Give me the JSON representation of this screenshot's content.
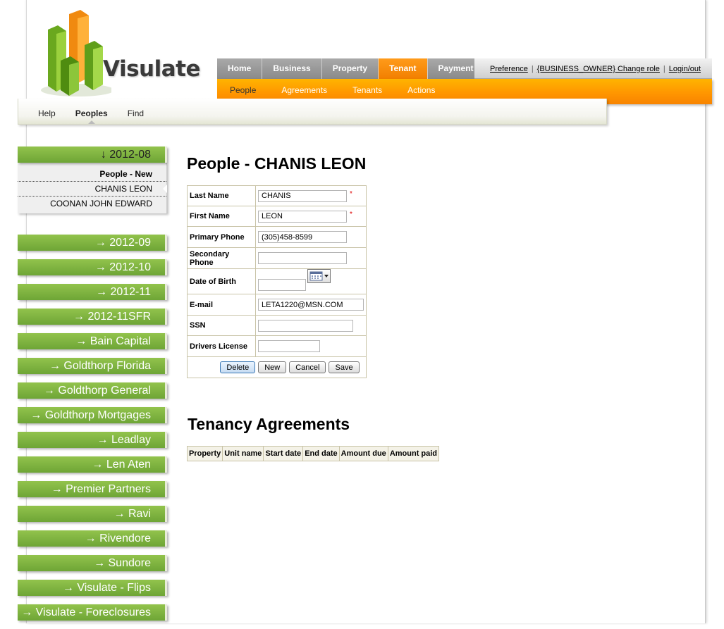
{
  "brand": {
    "name": "Visulate"
  },
  "topnav": {
    "tabs": [
      {
        "label": "Home",
        "active": false
      },
      {
        "label": "Business",
        "active": false
      },
      {
        "label": "Property",
        "active": false
      },
      {
        "label": "Tenant",
        "active": true
      },
      {
        "label": "Payment",
        "active": false
      }
    ],
    "links": [
      "Preference",
      "{BUSINESS_OWNER} Change role",
      "Login/out"
    ]
  },
  "subnav": {
    "items": [
      {
        "label": "People",
        "active": true
      },
      {
        "label": "Agreements",
        "active": false
      },
      {
        "label": "Tenants",
        "active": false
      },
      {
        "label": "Actions",
        "active": false
      }
    ]
  },
  "tertnav": {
    "items": [
      {
        "label": "Help",
        "active": false
      },
      {
        "label": "Peoples",
        "active": true
      },
      {
        "label": "Find",
        "active": false
      }
    ]
  },
  "sidebar": {
    "open_group": "↓ 2012-08",
    "submenu": [
      "People - New",
      "CHANIS LEON",
      "COONAN JOHN EDWARD"
    ],
    "groups": [
      "→ 2012-09",
      "→ 2012-10",
      "→ 2012-11",
      "→ 2012-11SFR",
      "→ Bain Capital",
      "→ Goldthorp Florida",
      "→ Goldthorp General",
      "→ Goldthorp Mortgages",
      "→ Leadlay",
      "→ Len Aten",
      "→ Premier Partners",
      "→ Ravi",
      "→ Rivendore",
      "→ Sundore",
      "→ Visulate - Flips",
      "→ Visulate - Foreclosures"
    ]
  },
  "people": {
    "title": "People - CHANIS LEON",
    "fields": {
      "last_name": {
        "label": "Last Name",
        "value": "CHANIS",
        "required": "*"
      },
      "first_name": {
        "label": "First Name",
        "value": "LEON",
        "required": "*"
      },
      "primary_phone": {
        "label": "Primary Phone",
        "value": "(305)458-8599"
      },
      "secondary_phone": {
        "label": "Secondary Phone",
        "value": ""
      },
      "dob": {
        "label": "Date of Birth",
        "value": ""
      },
      "email": {
        "label": "E-mail",
        "value": "LETA1220@MSN.COM"
      },
      "ssn": {
        "label": "SSN",
        "value": ""
      },
      "drivers_license": {
        "label": "Drivers License",
        "value": ""
      }
    },
    "buttons": {
      "delete": "Delete",
      "new": "New",
      "cancel": "Cancel",
      "save": "Save"
    }
  },
  "agreements": {
    "title": "Tenancy Agreements",
    "columns": [
      "Property",
      "Unit name",
      "Start date",
      "End date",
      "Amount due",
      "Amount paid"
    ]
  },
  "colors": {
    "accent_orange": "#ff9400",
    "nav_gray": "#8a8a8a",
    "sidebar_green": "#7bb33e"
  },
  "icons": {
    "calendar": "calendar-icon",
    "logo": "visulate-logo-bars"
  }
}
